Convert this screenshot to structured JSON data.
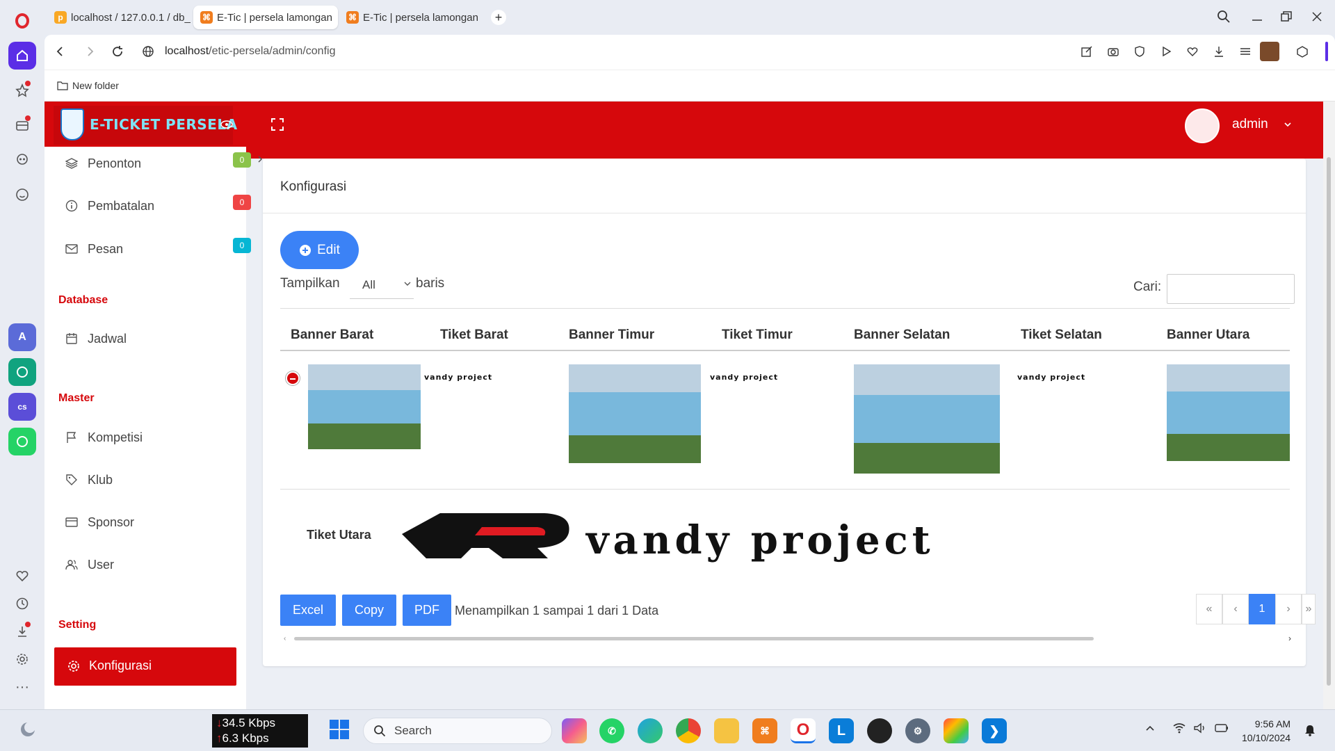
{
  "browser": {
    "tabs": [
      {
        "label": "localhost / 127.0.0.1 / db_"
      },
      {
        "label": "E-Tic | persela lamongan"
      },
      {
        "label": "E-Tic | persela lamongan"
      }
    ],
    "url_host": "localhost",
    "url_path": "/etic-persela/admin/config",
    "bookmark_folder": "New folder"
  },
  "app": {
    "brand": "E-TICKET PERSELA",
    "user": "admin",
    "accent": "#d6080c",
    "primary": "#3b82f6"
  },
  "sidebar": {
    "items_top": [
      {
        "label": "Penonton",
        "badge": "0",
        "badge_color": "#8bc34a"
      },
      {
        "label": "Pembatalan",
        "badge": "0",
        "badge_color": "#ef4444"
      },
      {
        "label": "Pesan",
        "badge": "0",
        "badge_color": "#06b6d4"
      }
    ],
    "section_database": "Database",
    "database_items": [
      {
        "label": "Jadwal"
      }
    ],
    "section_master": "Master",
    "master_items": [
      {
        "label": "Kompetisi"
      },
      {
        "label": "Klub"
      },
      {
        "label": "Sponsor"
      },
      {
        "label": "User"
      }
    ],
    "section_setting": "Setting",
    "setting_active": "Konfigurasi"
  },
  "content": {
    "title": "Konfigurasi",
    "edit_label": "Edit",
    "show_label": "Tampilkan",
    "show_value": "All",
    "rows_label": "baris",
    "search_label": "Cari:",
    "columns": [
      "Banner Barat",
      "Tiket Barat",
      "Banner Timur",
      "Tiket Timur",
      "Banner Selatan",
      "Tiket Selatan",
      "Banner Utara"
    ],
    "child_label": "Tiket Utara",
    "logo_text": "vandy project",
    "export_buttons": [
      "Excel",
      "Copy",
      "PDF"
    ],
    "info": "Menampilkan 1 sampai 1 dari 1 Data",
    "pagination": [
      "«",
      "‹",
      "1",
      "›",
      "»"
    ]
  },
  "taskbar": {
    "net_down": "34.5 Kbps",
    "net_up": "6.3 Kbps",
    "search": "Search",
    "time": "9:56 AM",
    "date": "10/10/2024"
  }
}
